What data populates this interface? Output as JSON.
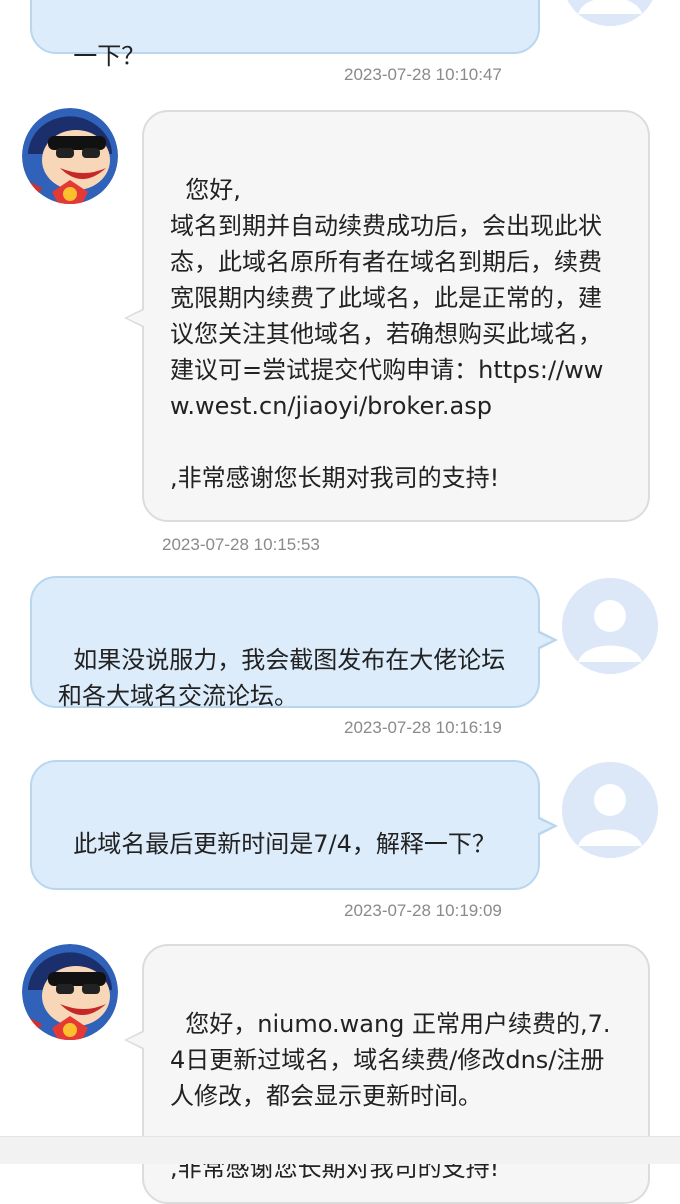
{
  "messages": [
    {
      "role": "user",
      "text": "一下？",
      "time": "2023-07-28 10:10:47"
    },
    {
      "role": "agent",
      "text": "您好,\n域名到期并自动续费成功后，会出现此状态，此域名原所有者在域名到期后，续费宽限期内续费了此域名，此是正常的，建议您关注其他域名，若确想购买此域名，建议可=尝试提交代购申请：https://www.west.cn/jiaoyi/broker.asp\n\n,非常感谢您长期对我司的支持!",
      "time": "2023-07-28 10:15:53"
    },
    {
      "role": "user",
      "text": "如果没说服力，我会截图发布在大佬论坛和各大域名交流论坛。",
      "time": "2023-07-28 10:16:19"
    },
    {
      "role": "user",
      "text": "此域名最后更新时间是7/4，解释一下？",
      "time": "2023-07-28 10:19:09"
    },
    {
      "role": "agent",
      "text": "您好，niumo.wang 正常用户续费的,7.4日更新过域名，域名续费/修改dns/注册人修改，都会显示更新时间。\n\n,非常感谢您长期对我司的支持!",
      "time": ""
    }
  ],
  "icons": {
    "agent_avatar": "cartoon-agent-avatar-icon",
    "user_avatar": "default-user-avatar-icon"
  },
  "colors": {
    "user_bubble": "#dcecfb",
    "agent_bubble": "#f6f6f6",
    "timestamp": "#8a8a8a"
  }
}
